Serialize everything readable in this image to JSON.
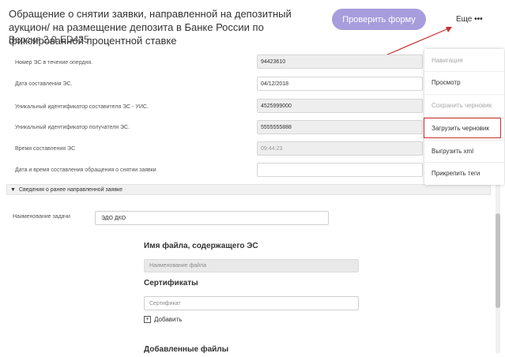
{
  "header": {
    "title": "Обращение о снятии заявки, направленной на депозитный аукцион/ на размещение депозита в Банке России по фиксированной процентной ставке",
    "version": "Версия 2.0",
    "code": "ED435",
    "check_button": "Проверить форму",
    "more_label": "Еще",
    "more_dots": "•••"
  },
  "form": {
    "rows": [
      {
        "label": "Номер ЭС в течение опердня.",
        "value": "94423610"
      },
      {
        "label": "Дата составления ЭС.",
        "value": "04/12/2018"
      },
      {
        "label": "Уникальный идентификатор составителя ЭС - УИС.",
        "value": "4525999000"
      },
      {
        "label": "Уникальный идентификатор получателя ЭС.",
        "value": "5555555888"
      },
      {
        "label": "Время составления ЭС",
        "value": "09:44:23"
      },
      {
        "label": "Дата и время составления обращения о снятии заявки",
        "value": ""
      }
    ],
    "section_title": "Сведения о ранее направленной заявке",
    "task_label": "Наименование задачи",
    "task_value": "ЭДО ДКО",
    "file_heading": "Имя файла, содержащего ЭС",
    "file_placeholder": "Наименование файла",
    "certs_heading": "Сертификаты",
    "cert_placeholder": "Сертификат",
    "add_label": "Добавить",
    "added_heading": "Добавленные файлы"
  },
  "menu": {
    "items": [
      {
        "label": "Навигация",
        "disabled": true
      },
      {
        "label": "Просмотр",
        "disabled": false
      },
      {
        "label": "Сохранить черновик",
        "disabled": true
      },
      {
        "label": "Загрузить черновик",
        "disabled": false,
        "highlighted": true
      },
      {
        "label": "Выгрузить xml",
        "disabled": false
      },
      {
        "label": "Прикрепить теги",
        "disabled": false
      }
    ]
  },
  "colors": {
    "accent": "#a79ddd",
    "highlight": "#c83030"
  }
}
